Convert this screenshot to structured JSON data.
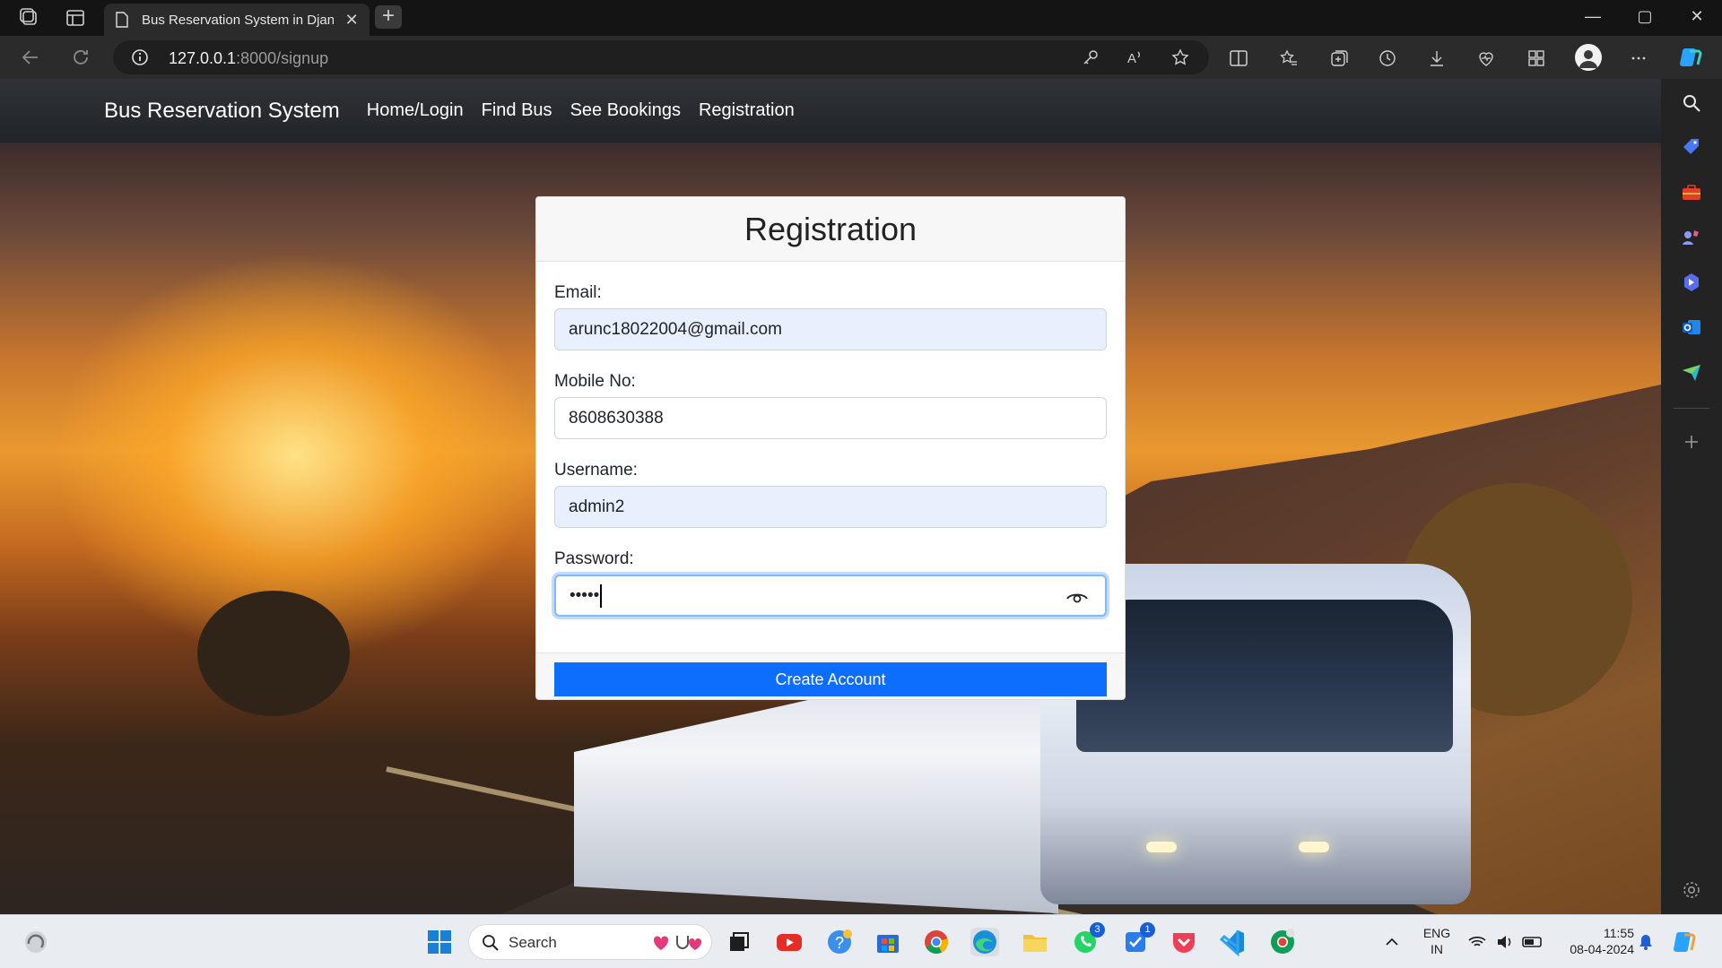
{
  "browser": {
    "tab_title": "Bus Reservation System in Djang",
    "tab_close": "✕",
    "new_tab": "+",
    "url_host": "127.0.0.1",
    "url_path": ":8000/signup",
    "window_controls": [
      "—",
      "▢",
      "✕"
    ]
  },
  "navbar": {
    "brand": "Bus Reservation System",
    "links": [
      "Home/Login",
      "Find Bus",
      "See Bookings",
      "Registration"
    ]
  },
  "form": {
    "title": "Registration",
    "fields": [
      {
        "label": "Email:",
        "value": "arunc18022004@gmail.com"
      },
      {
        "label": "Mobile No:",
        "value": "8608630388"
      },
      {
        "label": "Username:",
        "value": "admin2"
      },
      {
        "label": "Password:",
        "value": "•••••"
      }
    ],
    "submit_label": "Create Account"
  },
  "taskbar": {
    "search_label": "Search",
    "badges": {
      "whatsapp": "3",
      "todo": "1"
    },
    "lang_line1": "ENG",
    "lang_line2": "IN",
    "time": "11:55",
    "date": "08-04-2024"
  },
  "colors": {
    "primary_button": "#0d6efd",
    "navbar": "#212529",
    "autofill": "#e8f0fe",
    "focus_ring": "#86b7fe"
  }
}
